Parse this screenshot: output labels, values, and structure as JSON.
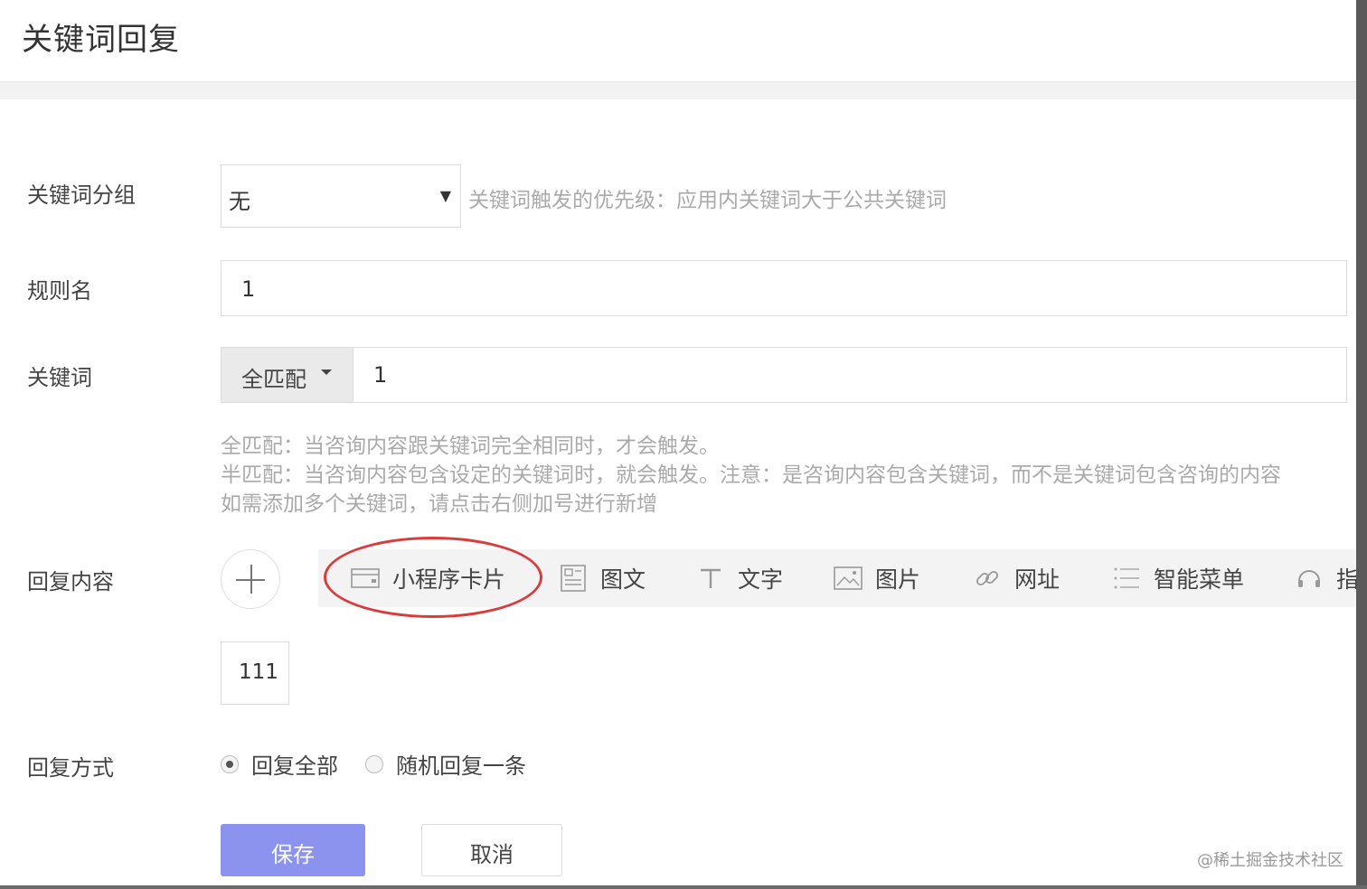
{
  "header": {
    "title": "关键词回复"
  },
  "form": {
    "group": {
      "label": "关键词分组",
      "value": "无",
      "hint": "关键词触发的优先级：应用内关键词大于公共关键词"
    },
    "rule": {
      "label": "规则名",
      "value": "1"
    },
    "keyword": {
      "label": "关键词",
      "match_mode": "全匹配",
      "value": "1",
      "help": [
        "全匹配：当咨询内容跟关键词完全相同时，才会触发。",
        "半匹配：当咨询内容包含设定的关键词时，就会触发。注意：是咨询内容包含关键词，而不是关键词包含咨询的内容",
        "如需添加多个关键词，请点击右侧加号进行新增"
      ]
    },
    "reply": {
      "label": "回复内容",
      "types": [
        {
          "label": "小程序卡片",
          "icon": "mini-program-card-icon"
        },
        {
          "label": "图文",
          "icon": "article-icon"
        },
        {
          "label": "文字",
          "icon": "text-icon"
        },
        {
          "label": "图片",
          "icon": "image-icon"
        },
        {
          "label": "网址",
          "icon": "link-icon"
        },
        {
          "label": "智能菜单",
          "icon": "menu-list-icon"
        },
        {
          "label": "指",
          "icon": "headset-icon"
        }
      ],
      "item": "111"
    },
    "mode": {
      "label": "回复方式",
      "options": [
        "回复全部",
        "随机回复一条"
      ],
      "selected": "回复全部"
    }
  },
  "actions": {
    "save": "保存",
    "cancel": "取消"
  },
  "watermark": "@稀土掘金技术社区",
  "colors": {
    "primary": "#8b93ee",
    "highlight": "#d93c3c",
    "hint": "#aaaaaa"
  }
}
